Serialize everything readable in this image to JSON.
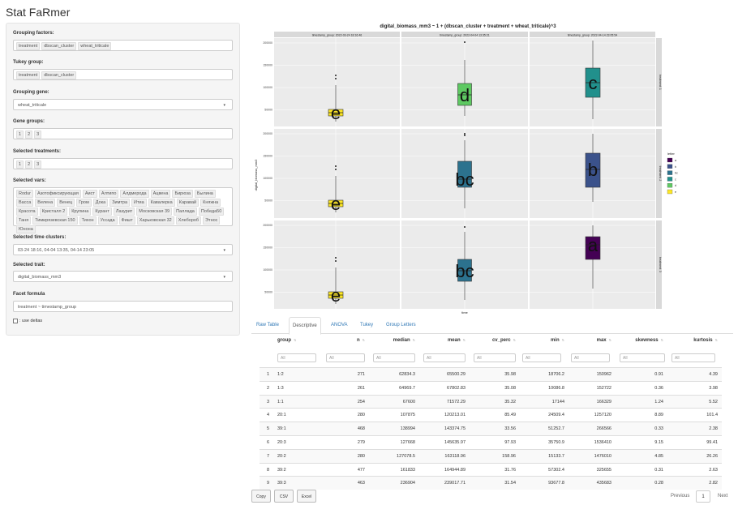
{
  "app": {
    "title": "Stat FaRmer"
  },
  "sidebar": {
    "grouping_factors": {
      "label": "Grouping factors:",
      "tags": [
        "treatment",
        "dbscan_cluster",
        "wheat_triticale"
      ]
    },
    "tukey_group": {
      "label": "Tukey group:",
      "tags": [
        "treatment",
        "dbscan_cluster"
      ]
    },
    "grouping_gene": {
      "label": "Grouping gene:",
      "value": "wheat_triticale"
    },
    "gene_groups": {
      "label": "Gene groups:",
      "tags": [
        "1",
        "2",
        "3"
      ]
    },
    "selected_treatments": {
      "label": "Selected treatments:",
      "tags": [
        "1",
        "2",
        "3"
      ]
    },
    "selected_vars": {
      "label": "Selected vars:",
      "tags": [
        "Rodur",
        "Азотофиксирующая",
        "Аист",
        "Алтипо",
        "Алдмерода",
        "Ацвена",
        "Бирюза",
        "Былина",
        "Васса",
        "Велена",
        "Венец",
        "Гром",
        "Дока",
        "Зимтра",
        "Итиа",
        "Кавалерка",
        "Каравай",
        "Княжна",
        "Красота",
        "Кристалл 2",
        "Крупина",
        "Курант",
        "Лазурит",
        "Московская 39",
        "Паллада",
        "Победа50",
        "Таня",
        "Тимирязевская 150",
        "Тихон",
        "Уссада",
        "Фишт",
        "Харьковская 32",
        "Хлебороб",
        "Этнос",
        "Юнона"
      ]
    },
    "time_clusters": {
      "label": "Selected time clusters:",
      "value": "03-24 18:16, 04-04 13:35, 04-14 23:05"
    },
    "trait": {
      "label": "Selected trait:",
      "value": "digital_biomass_mm3"
    },
    "facet_formula": {
      "label": "Facet formula",
      "value": "treatment ~ timestamp_group"
    },
    "use_deltas": {
      "label": ": use deltas"
    }
  },
  "plot": {
    "title": "digital_biomass_mm3 ~ 1 + (dbscan_cluster + treatment + wheat_triticale)^3",
    "ylabel": "digital_biomass_mm3",
    "xlabel": "time",
    "columns": [
      "timestamp_group: 2022-03-24 18:16:46",
      "timestamp_group: 2022-04-04 13:35:21",
      "timestamp_group: 2022-04-14 23:05:54"
    ],
    "rows": [
      "treatment: 1",
      "treatment: 2",
      "treatment: 3"
    ],
    "yticks": [
      [
        "200000",
        "150000",
        "100000",
        "50000"
      ],
      [
        "200000",
        "150000",
        "100000",
        "50000"
      ],
      [
        "200000",
        "150000",
        "100000",
        "50000"
      ]
    ],
    "legend_title": "letter",
    "legend_items": [
      {
        "label": "a",
        "color": "#440154"
      },
      {
        "label": "b",
        "color": "#3b528b"
      },
      {
        "label": "bc",
        "color": "#2c728e"
      },
      {
        "label": "c",
        "color": "#21908c"
      },
      {
        "label": "d",
        "color": "#5ec962"
      },
      {
        "label": "e",
        "color": "#fde725"
      }
    ],
    "panels": [
      [
        {
          "letter": "e",
          "color": "#fde725"
        },
        {
          "letter": "d",
          "color": "#5ec962"
        },
        {
          "letter": "c",
          "color": "#21908c"
        }
      ],
      [
        {
          "letter": "e",
          "color": "#fde725"
        },
        {
          "letter": "bc",
          "color": "#2c728e"
        },
        {
          "letter": "b",
          "color": "#3b528b"
        }
      ],
      [
        {
          "letter": "e",
          "color": "#fde725"
        },
        {
          "letter": "bc",
          "color": "#2c728e"
        },
        {
          "letter": "a",
          "color": "#440154"
        }
      ]
    ]
  },
  "tabs": [
    "Raw Table",
    "Descriptive",
    "ANOVA",
    "Tukey",
    "Group Letters"
  ],
  "active_tab": "Descriptive",
  "table": {
    "headers": [
      "group",
      "n",
      "median",
      "mean",
      "cv_perc",
      "min",
      "max",
      "skewness",
      "kurtosis"
    ],
    "filter_placeholder": "All",
    "rows": [
      [
        "1",
        "1:2",
        "271",
        "62834.3",
        "65500.29",
        "35.98",
        "18706.2",
        "150962",
        "0.91",
        "4.39"
      ],
      [
        "2",
        "1:3",
        "261",
        "64969.7",
        "67802.83",
        "35.08",
        "10086.8",
        "152722",
        "0.36",
        "3.98"
      ],
      [
        "3",
        "1:1",
        "254",
        "67600",
        "71572.29",
        "35.32",
        "17144",
        "166329",
        "1.24",
        "5.52"
      ],
      [
        "4",
        "20:1",
        "280",
        "107875",
        "120213.01",
        "85.49",
        "24509.4",
        "1257120",
        "8.89",
        "101.4"
      ],
      [
        "5",
        "39:1",
        "468",
        "138994",
        "143374.75",
        "33.56",
        "51252.7",
        "266566",
        "0.33",
        "2.38"
      ],
      [
        "6",
        "20:3",
        "279",
        "127668",
        "145635.97",
        "97.93",
        "35750.9",
        "1536410",
        "9.15",
        "99.41"
      ],
      [
        "7",
        "20:2",
        "280",
        "127078.5",
        "163118.96",
        "158.96",
        "15133.7",
        "1476010",
        "4.85",
        "26.26"
      ],
      [
        "8",
        "39:2",
        "477",
        "161833",
        "164944.89",
        "31.76",
        "57302.4",
        "325655",
        "0.31",
        "2.63"
      ],
      [
        "9",
        "39:3",
        "463",
        "236904",
        "239017.71",
        "31.54",
        "93677.8",
        "435683",
        "0.28",
        "2.82"
      ]
    ]
  },
  "buttons": {
    "copy": "Copy",
    "csv": "CSV",
    "excel": "Excel"
  },
  "pagination": {
    "previous": "Previous",
    "current": "1",
    "next": "Next"
  }
}
